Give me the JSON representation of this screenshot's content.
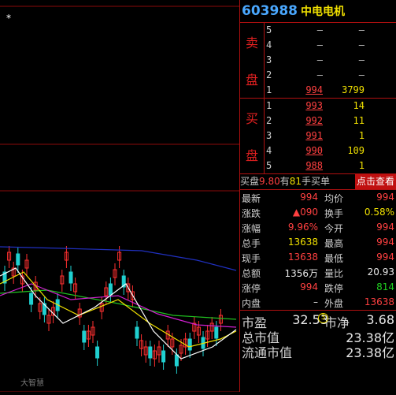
{
  "stock": {
    "code": "603988",
    "name": "中电电机"
  },
  "orderbook": {
    "sell_label": [
      "卖",
      "盘"
    ],
    "buy_label": [
      "买",
      "盘"
    ],
    "sell": [
      {
        "level": "5",
        "price": "–",
        "vol": "–"
      },
      {
        "level": "4",
        "price": "–",
        "vol": "–"
      },
      {
        "level": "3",
        "price": "–",
        "vol": "–"
      },
      {
        "level": "2",
        "price": "–",
        "vol": "–"
      },
      {
        "level": "1",
        "price": "994",
        "vol": "3799"
      }
    ],
    "buy": [
      {
        "level": "1",
        "price": "993",
        "vol": "14"
      },
      {
        "level": "2",
        "price": "992",
        "vol": "11"
      },
      {
        "level": "3",
        "price": "991",
        "vol": "1"
      },
      {
        "level": "4",
        "price": "990",
        "vol": "109"
      },
      {
        "level": "5",
        "price": "988",
        "vol": "1"
      }
    ]
  },
  "note": {
    "a": "买盘",
    "b": "9.80",
    "c": "有",
    "d": "81",
    "e": "手买单",
    "btn": "点击查看"
  },
  "stats": [
    {
      "l1": "最新",
      "v1": "994",
      "c1": "red",
      "l2": "均价",
      "v2": "994",
      "c2": "red"
    },
    {
      "l1": "涨跌",
      "v1": "▲090",
      "c1": "red",
      "l2": "换手",
      "v2": "0.58%",
      "c2": "yel"
    },
    {
      "l1": "涨幅",
      "v1": "9.96%",
      "c1": "red",
      "l2": "今开",
      "v2": "994",
      "c2": "red"
    },
    {
      "l1": "总手",
      "v1": "13638",
      "c1": "yel",
      "l2": "最高",
      "v2": "994",
      "c2": "red"
    },
    {
      "l1": "现手",
      "v1": "13638",
      "c1": "red",
      "l2": "最低",
      "v2": "994",
      "c2": "red"
    },
    {
      "l1": "总额",
      "v1": "1356万",
      "c1": "wht",
      "l2": "量比",
      "v2": "20.93",
      "c2": "wht"
    },
    {
      "l1": "涨停",
      "v1": "994",
      "c1": "red",
      "l2": "跌停",
      "v2": "814",
      "c2": "grn"
    },
    {
      "l1": "内盘",
      "v1": "–",
      "c1": "wht",
      "l2": "外盘",
      "v2": "13638",
      "c2": "red"
    }
  ],
  "valuation": [
    {
      "l1": "市盈",
      "v1": "32.53",
      "badge": "3",
      "l2": "市净",
      "v2": "3.68"
    },
    {
      "l1": "总市值",
      "v1": "",
      "l2": "",
      "v2": "23.38亿"
    },
    {
      "l1": "流通市值",
      "v1": "",
      "l2": "",
      "v2": "23.38亿"
    }
  ],
  "chart_data": {
    "type": "candlestick",
    "colors": {
      "up": "#ff3030",
      "down": "#20d0d0",
      "ma5": "#ffffff",
      "ma10": "#f0e000",
      "ma20": "#d020d0",
      "ma60": "#20c020",
      "ma120": "#2030c0"
    },
    "watermark": "大智慧"
  }
}
